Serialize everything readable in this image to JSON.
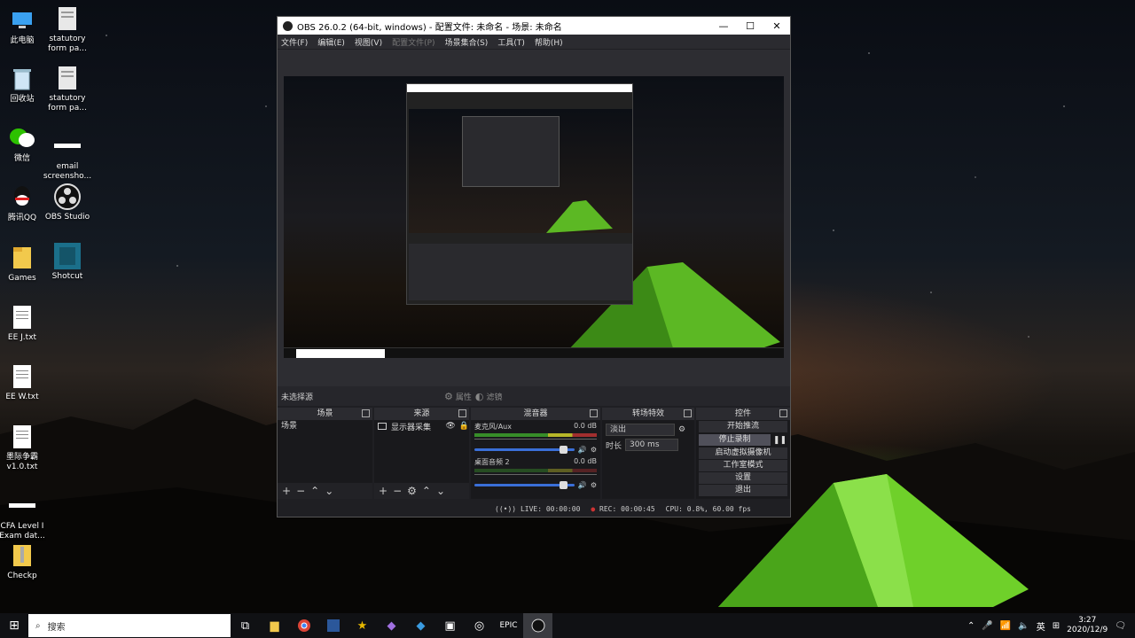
{
  "desktop": {
    "icons": [
      {
        "label": "此电脑",
        "icon": "computer-icon"
      },
      {
        "label": "statutory form pa...",
        "icon": "document-icon"
      },
      {
        "label": "回收站",
        "icon": "recycle-bin-icon"
      },
      {
        "label": "statutory form pa...",
        "icon": "document-icon"
      },
      {
        "label": "微信",
        "icon": "wechat-icon"
      },
      {
        "label": "email screensho...",
        "icon": "image-file-icon"
      },
      {
        "label": "腾讯QQ",
        "icon": "qq-icon"
      },
      {
        "label": "OBS Studio",
        "icon": "obs-icon"
      },
      {
        "label": "Games",
        "icon": "folder-icon"
      },
      {
        "label": "Shotcut",
        "icon": "shotcut-icon"
      },
      {
        "label": "EE J.txt",
        "icon": "text-file-icon"
      },
      {
        "label": "EE W.txt",
        "icon": "text-file-icon"
      },
      {
        "label": "墨际争霸 v1.0.txt",
        "icon": "text-file-icon"
      },
      {
        "label": "CFA Level I Exam dat...",
        "icon": "image-file-icon"
      },
      {
        "label": "Checkp",
        "icon": "zip-file-icon"
      }
    ]
  },
  "obs": {
    "title": "OBS 26.0.2 (64-bit, windows) - 配置文件: 未命名 - 场景: 未命名",
    "menu": [
      "文件(F)",
      "编辑(E)",
      "视图(V)",
      "配置文件(P)",
      "场景集合(S)",
      "工具(T)",
      "帮助(H)"
    ],
    "no_source_selected": "未选择源",
    "properties_label": "属性",
    "filters_label": "滤镜",
    "docks": {
      "scenes": {
        "title": "场景",
        "items": [
          "场景"
        ]
      },
      "sources": {
        "title": "来源",
        "items": [
          "显示器采集"
        ]
      },
      "mixer": {
        "title": "混音器",
        "tracks": [
          {
            "name": "麦克风/Aux",
            "db": "0.0 dB"
          },
          {
            "name": "桌面音频 2",
            "db": "0.0 dB"
          }
        ]
      },
      "transitions": {
        "title": "转场特效",
        "selected": "淡出",
        "duration_label": "时长",
        "duration_value": "300 ms"
      },
      "controls": {
        "title": "控件",
        "buttons": [
          "开始推流",
          "停止录制",
          "启动虚拟摄像机",
          "工作室模式",
          "设置",
          "退出"
        ]
      }
    },
    "status": {
      "live": "LIVE: 00:00:00",
      "rec": "REC: 00:00:45",
      "cpu": "CPU: 0.8%, 60.00 fps"
    }
  },
  "taskbar": {
    "search_placeholder": "搜索",
    "ime": "英",
    "time": "3:27",
    "date": "2020/12/9"
  }
}
